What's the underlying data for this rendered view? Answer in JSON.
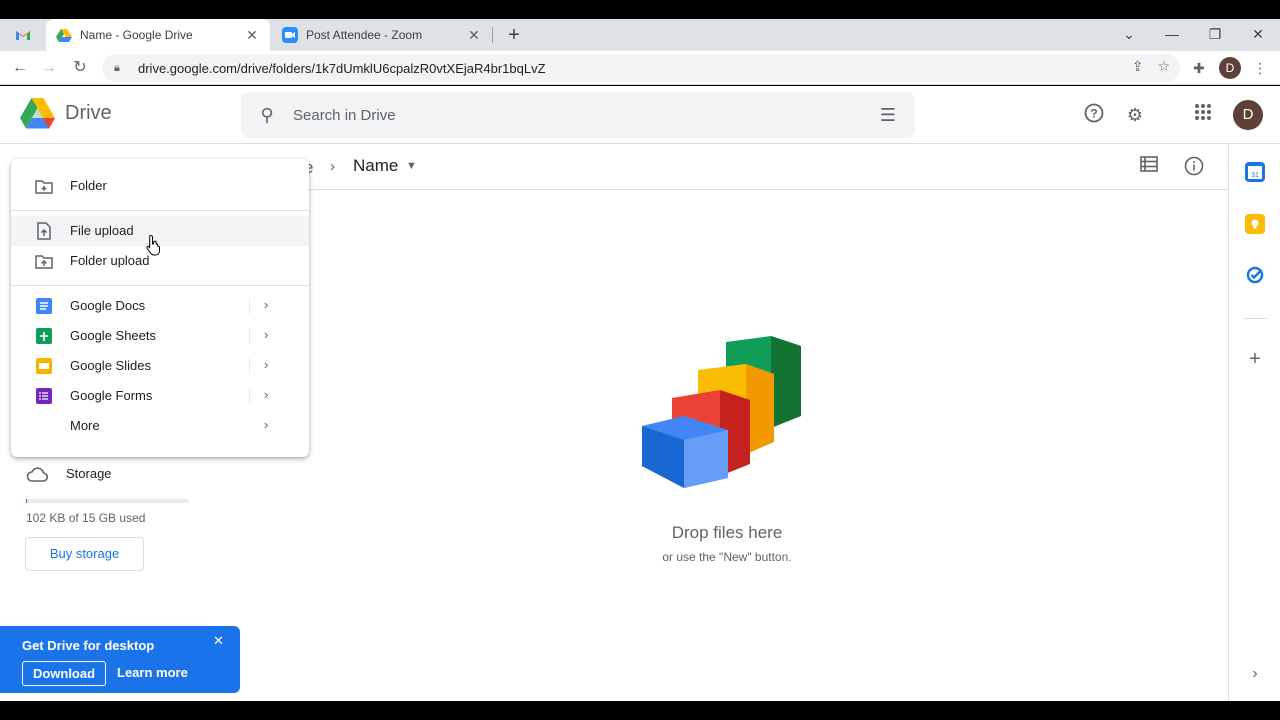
{
  "browser": {
    "tabs": [
      {
        "title": "",
        "favicon": "gmail-icon"
      },
      {
        "title": "Name - Google Drive",
        "favicon": "google-drive-icon",
        "active": true
      },
      {
        "title": "Post Attendee - Zoom",
        "favicon": "zoom-icon"
      }
    ],
    "tab_close": "✕",
    "new_tab": "+",
    "window": {
      "minimize": "—",
      "restore": "❐",
      "close": "✕",
      "dropdown": "⌄"
    },
    "url": "drive.google.com/drive/folders/1k7dUmklU6cpalzR0vtXEjaR4br1bqLvZ",
    "profile_initial": "D"
  },
  "drive": {
    "app_name": "Drive",
    "search_placeholder": "Search in Drive",
    "avatar_initial": "D",
    "breadcrumb": {
      "previous": "e",
      "current": "Name"
    },
    "new_menu": {
      "items": [
        {
          "label": "Folder"
        },
        {
          "label": "File upload"
        },
        {
          "label": "Folder upload"
        },
        {
          "label": "Google Docs"
        },
        {
          "label": "Google Sheets"
        },
        {
          "label": "Google Slides"
        },
        {
          "label": "Google Forms"
        },
        {
          "label": "More"
        }
      ]
    },
    "storage": {
      "label": "Storage",
      "used_text": "102 KB of 15 GB used",
      "used_fraction": 0.001,
      "buy_label": "Buy storage"
    },
    "empty_state": {
      "title": "Drop files here",
      "subtitle": "or use the \"New\" button."
    },
    "promo": {
      "title": "Get Drive for desktop",
      "download_label": "Download",
      "learn_more_label": "Learn more",
      "close": "✕"
    }
  },
  "colors": {
    "accent": "#1a73e8",
    "docs": "#4285f4",
    "sheets": "#0f9d58",
    "slides": "#f4b400",
    "forms": "#7627bb"
  }
}
